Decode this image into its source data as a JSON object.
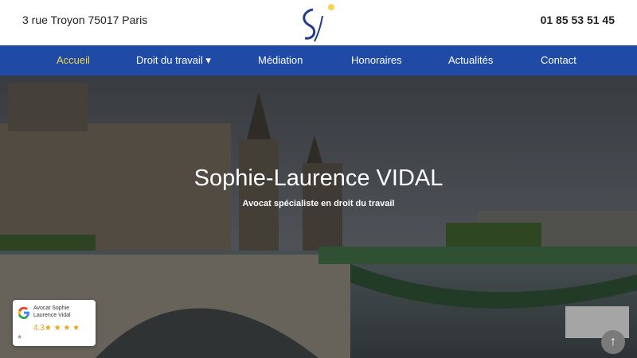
{
  "header": {
    "address": "3 rue Troyon 75017 Paris",
    "phone": "01 85 53 51 45",
    "logo_icon": "s-logo-icon"
  },
  "nav": {
    "items": [
      {
        "label": "Accueil"
      },
      {
        "label": "Droit du travail ▾"
      },
      {
        "label": "Médiation"
      },
      {
        "label": "Honoraires"
      },
      {
        "label": "Actualités"
      },
      {
        "label": "Contact"
      }
    ],
    "active_color": "#f2d64b",
    "bg_color": "#1f4aa6"
  },
  "hero": {
    "title": "Sophie-Laurence VIDAL",
    "subtitle": "Avocat spécialiste en droit du travail"
  },
  "review_widget": {
    "name": "Avocat Sophie Laurence Vidal",
    "rating": "4.3★ ★ ★ ★",
    "icon": "google-icon"
  },
  "scroll_top": {
    "glyph": "↑"
  }
}
